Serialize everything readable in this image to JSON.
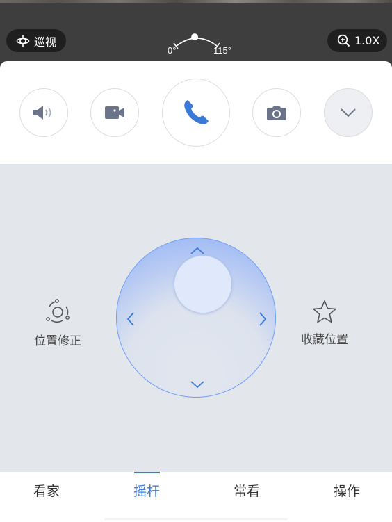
{
  "video": {
    "patrol_label": "巡视",
    "zoom_label": "1.0X",
    "angle": {
      "min_label": "0°",
      "max_label": "115°",
      "current_fraction": 0.45
    }
  },
  "actions": [
    {
      "icon": "speaker-icon",
      "name": "speaker"
    },
    {
      "icon": "video-record-icon",
      "name": "record"
    },
    {
      "icon": "phone-icon",
      "name": "call"
    },
    {
      "icon": "camera-icon",
      "name": "snapshot"
    },
    {
      "icon": "chevron-down-icon",
      "name": "more"
    }
  ],
  "joystick": {
    "left_action": {
      "label": "位置修正",
      "icon": "position-correction-icon"
    },
    "right_action": {
      "label": "收藏位置",
      "icon": "star-icon"
    }
  },
  "tabs": [
    {
      "label": "看家",
      "active": false
    },
    {
      "label": "摇杆",
      "active": true
    },
    {
      "label": "常看",
      "active": false
    },
    {
      "label": "操作",
      "active": false
    }
  ],
  "colors": {
    "accent": "#3b79d9",
    "joystick_ring": "#6f9ef7",
    "icon_gray": "#6c7489"
  }
}
